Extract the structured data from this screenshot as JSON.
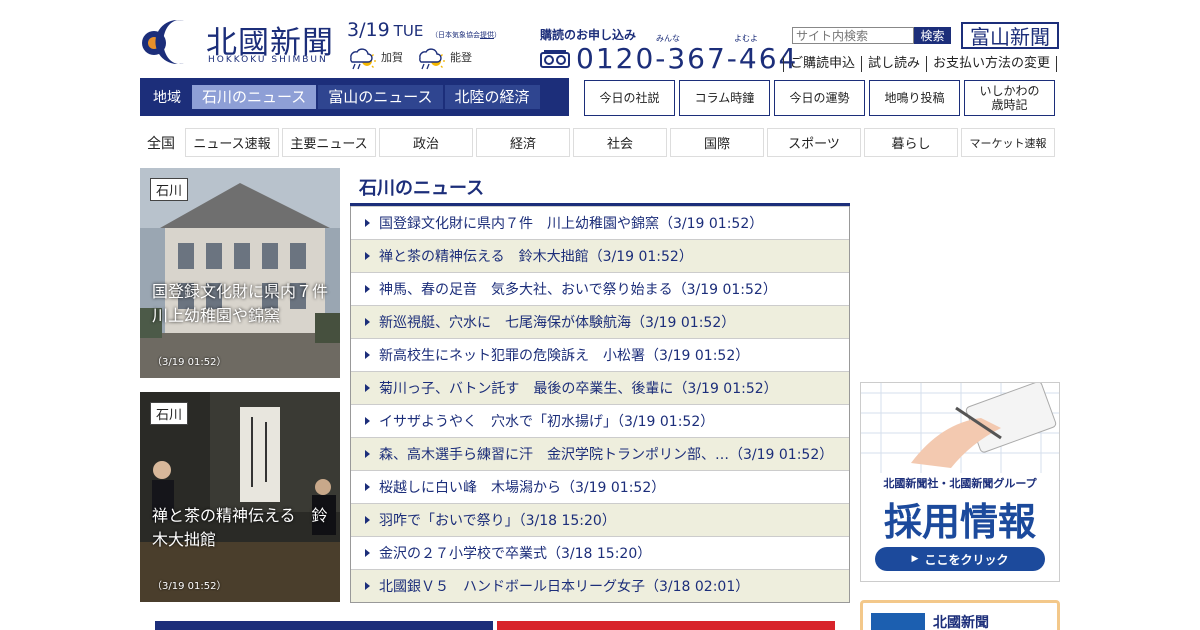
{
  "header": {
    "logo_kanji": "北國新聞",
    "logo_roman": "HOKKOKU SHIMBUN",
    "date": "3/19",
    "day_of_week": "TUE",
    "jma_note_prefix": "（日本気象協会",
    "jma_link": "提供",
    "jma_note_suffix": "）",
    "weather": [
      {
        "city": "加賀",
        "icon": "cloud-sun-rain-icon"
      },
      {
        "city": "能登",
        "icon": "cloud-sun-rain-icon"
      }
    ],
    "subscribe_title": "購読のお申し込み",
    "phone_ruby_1": "みんな",
    "phone_ruby_2": "よむよ",
    "phone_number": "0120-367-464",
    "search_placeholder": "サイト内検索",
    "search_button": "検索",
    "toyama_logo": "富山新聞",
    "sub_links": [
      "ご購読申込",
      "試し読み",
      "お支払い方法の変更"
    ]
  },
  "region_nav": {
    "label": "地域",
    "tabs": [
      "石川のニュース",
      "富山のニュース",
      "北陸の経済"
    ],
    "active_index": 0
  },
  "box_links": [
    "今日の社説",
    "コラム時鐘",
    "今日の運勢",
    "地鳴り投稿",
    "いしかわの\n歳時記"
  ],
  "category_nav": {
    "label": "全国",
    "items": [
      "ニュース速報",
      "主要ニュース",
      "政治",
      "経済",
      "社会",
      "国際",
      "スポーツ",
      "暮らし",
      "マーケット速報"
    ]
  },
  "photo_cards": [
    {
      "tag": "石川",
      "caption": "国登録文化財に県内７件　川上幼稚園や錦窯",
      "time": "（3/19 01:52）"
    },
    {
      "tag": "石川",
      "caption": "禅と茶の精神伝える　鈴木大拙館",
      "time": "（3/19 01:52）"
    }
  ],
  "news_section": {
    "title": "石川のニュース",
    "items": [
      "国登録文化財に県内７件　川上幼稚園や錦窯（3/19 01:52）",
      "禅と茶の精神伝える　鈴木大拙館（3/19 01:52）",
      "神馬、春の足音　気多大社、おいで祭り始まる（3/19 01:52）",
      "新巡視艇、穴水に　七尾海保が体験航海（3/19 01:52）",
      "新高校生にネット犯罪の危険訴え　小松署（3/19 01:52）",
      "菊川っ子、バトン託す　最後の卒業生、後輩に（3/19 01:52）",
      "イサザようやく　穴水で「初水揚げ」（3/19 01:52）",
      "森、高木選手ら練習に汗　金沢学院トランポリン部、…（3/19 01:52）",
      "桜越しに白い峰　木場潟から（3/19 01:52）",
      "羽咋で「おいで祭り」（3/18 15:20）",
      "金沢の２７小学校で卒業式（3/18 15:20）",
      "北國銀Ｖ５　ハンドボール日本リーグ女子（3/18 02:01）"
    ]
  },
  "ads": {
    "recruit_line1": "北國新聞社・北國新聞グループ",
    "recruit_line2": "採用情報",
    "recruit_button": "ここをクリック",
    "bottom_title": "北國新聞"
  },
  "colors": {
    "brand_navy": "#1c2e7a",
    "active_tab": "#8e9fd6",
    "list_stripe": "#eeeedd",
    "logo_orange": "#e8902a"
  }
}
